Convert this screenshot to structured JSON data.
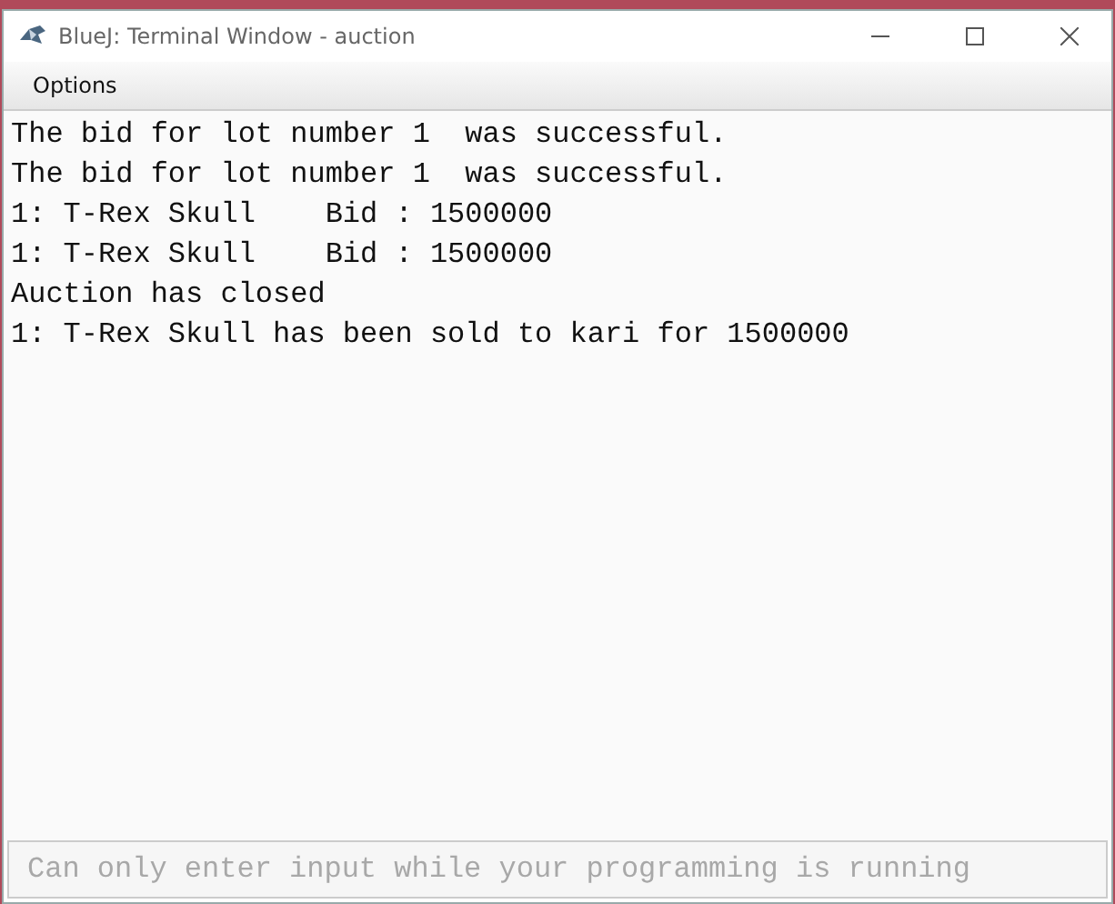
{
  "window": {
    "title": "BlueJ: Terminal Window - auction"
  },
  "menu": [
    "Options"
  ],
  "terminal": {
    "lines": [
      "The bid for lot number 1  was successful.",
      "The bid for lot number 1  was successful.",
      "1: T-Rex Skull    Bid : 1500000",
      "1: T-Rex Skull    Bid : 1500000",
      "Auction has closed",
      "1: T-Rex Skull has been sold to kari for 1500000"
    ]
  },
  "input": {
    "placeholder": "Can only enter input while your programming is running",
    "disabled": true
  }
}
